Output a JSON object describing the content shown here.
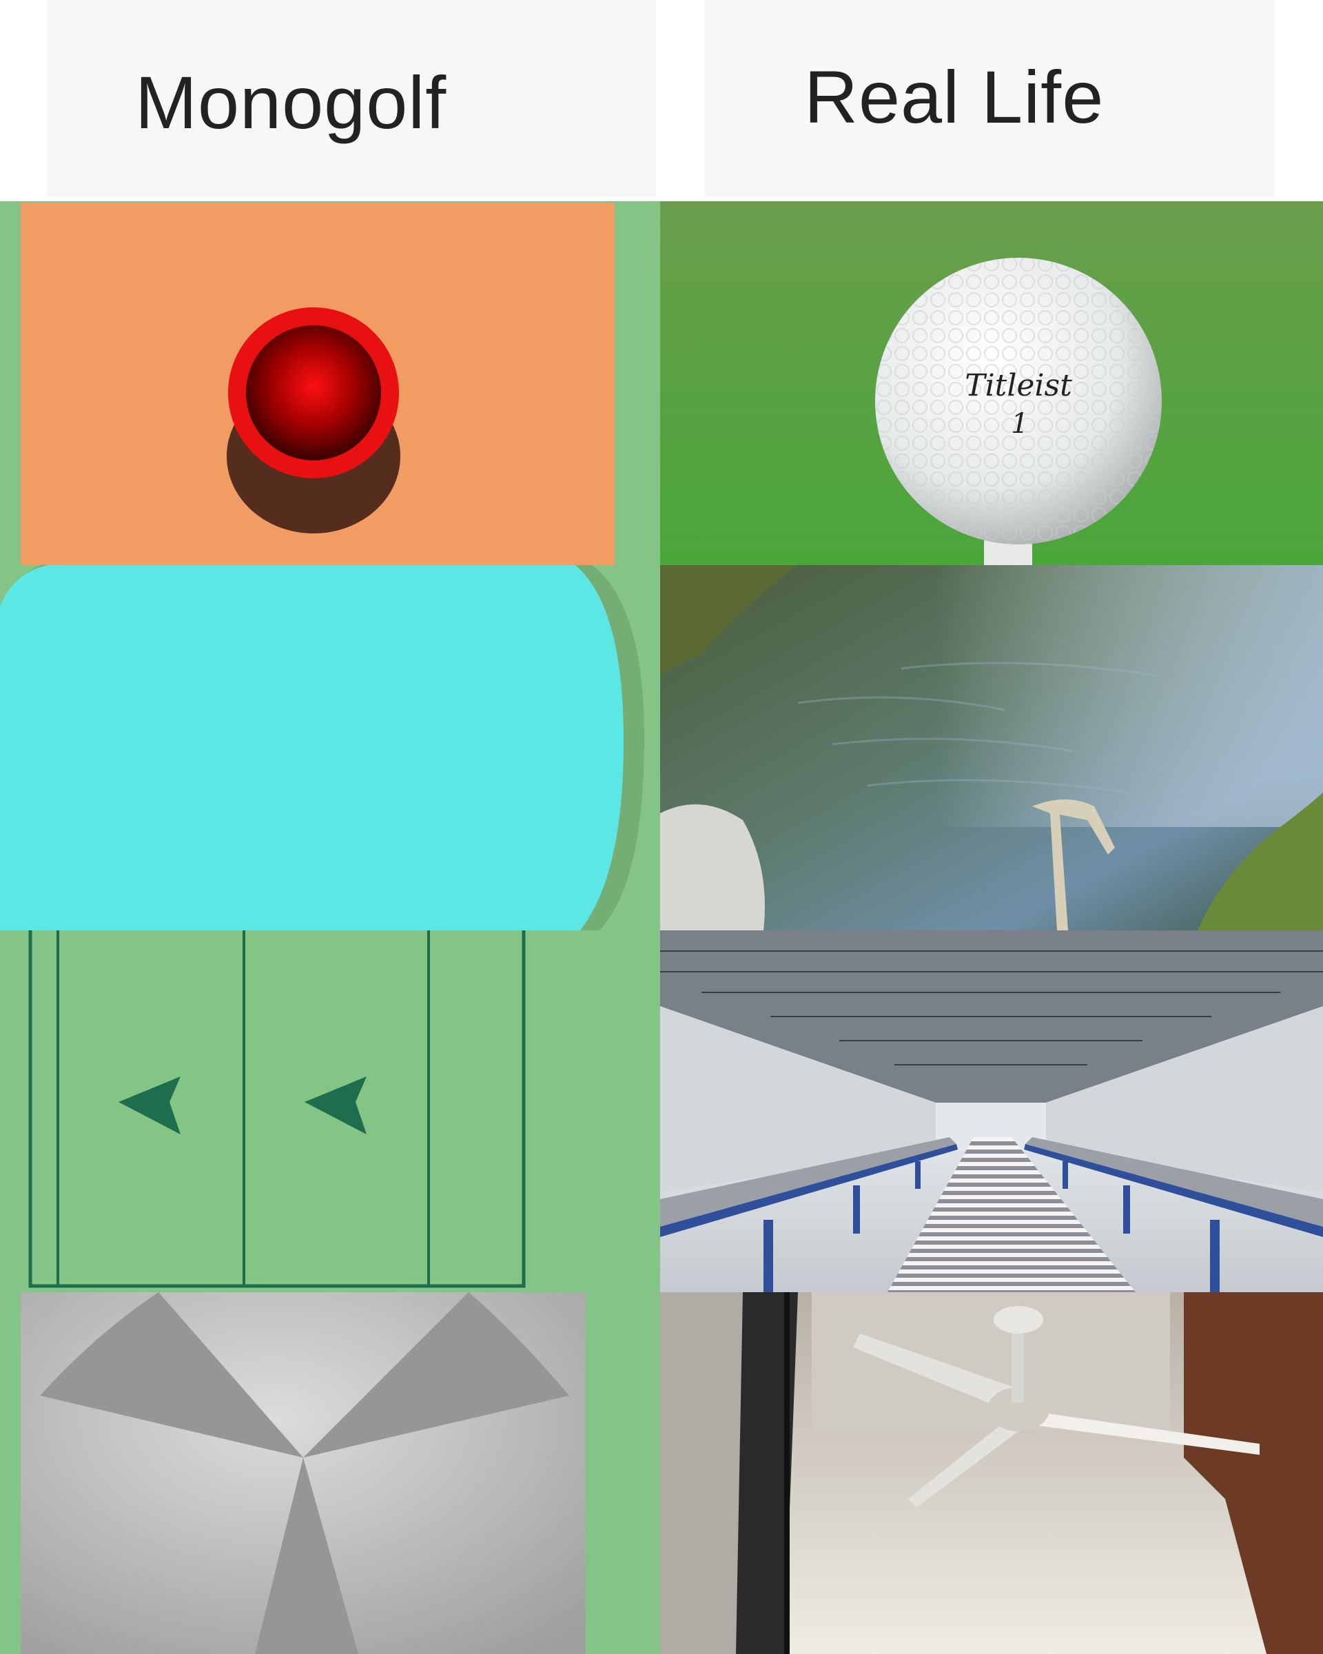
{
  "header": {
    "left_title": "Monogolf",
    "right_title": "Real Life"
  },
  "panels": [
    {
      "row": 1,
      "game": "ball-hole",
      "real": "golf-ball",
      "real_print": {
        "brand": "Titleist",
        "number": "1"
      }
    },
    {
      "row": 2,
      "game": "water-hazard",
      "real": "pond"
    },
    {
      "row": 3,
      "game": "conveyor-arrows",
      "real": "roller-conveyor-warehouse"
    },
    {
      "row": 4,
      "game": "fan-blades",
      "real": "ceiling-fan"
    }
  ],
  "colors": {
    "grass": "#84c486",
    "orange_tile": "#f19c63",
    "ball_red": "#e01010",
    "water": "#5de7e4",
    "arrow": "#1e6e4e",
    "fan_gray": "#b2b2b2",
    "fan_blade": "#969696"
  }
}
